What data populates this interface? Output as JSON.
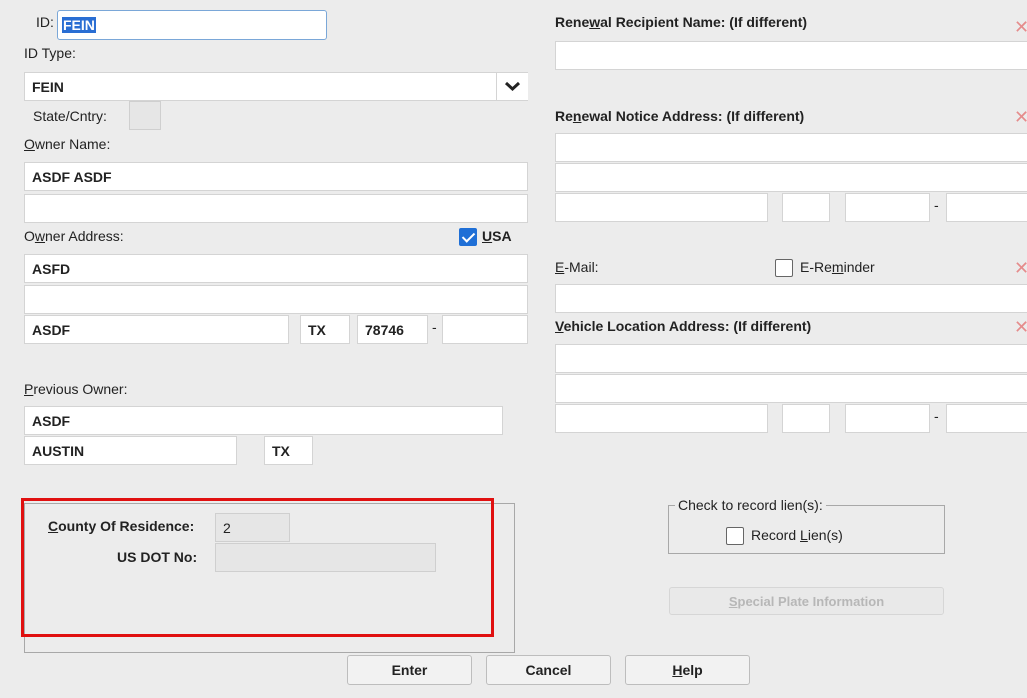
{
  "left": {
    "id_label": "ID:",
    "id_value": "FEIN",
    "id_type_label": "ID Type:",
    "id_type_value": "FEIN",
    "state_label": "State/Cntry:",
    "state_value": "",
    "owner_name_label_u": "O",
    "owner_name_label_rest": "wner Name:",
    "owner_name_1": "ASDF ASDF",
    "owner_name_2": "",
    "owner_address_label_pre": "O",
    "owner_address_label_u": "w",
    "owner_address_label_rest": "ner Address:",
    "usa_u": "U",
    "usa_rest": "SA",
    "address_1": "ASFD",
    "address_2": "",
    "city": "ASDF",
    "state": "TX",
    "zip": "78746",
    "zip_dash": "-",
    "zip_ext": "",
    "previous_owner_label_u": "P",
    "previous_owner_label_rest": "revious Owner:",
    "previous_owner_name": "ASDF",
    "previous_owner_city": "AUSTIN",
    "previous_owner_state": "TX"
  },
  "right": {
    "renewal_recipient_label_pre": "Rene",
    "renewal_recipient_label_u": "w",
    "renewal_recipient_label_rest": "al Recipient Name: (If different)",
    "renewal_recipient_value": "",
    "renewal_address_label_pre": "Re",
    "renewal_address_label_u": "n",
    "renewal_address_label_rest": "ewal Notice Address: (If different)",
    "renewal_dash": "-",
    "email_label_u": "E",
    "email_label_rest": "-Mail:",
    "ereminder_pre": "E-Re",
    "ereminder_u": "m",
    "ereminder_rest": "inder",
    "vehicle_label_u": "V",
    "vehicle_label_rest": "ehicle Location Address: (If different)",
    "vehicle_dash": "-"
  },
  "county": {
    "county_label_u": "C",
    "county_label_rest": "ounty Of Residence:",
    "county_value": "2",
    "dot_label": "US DOT No:",
    "dot_value": ""
  },
  "lien": {
    "group_label": "Check to record lien(s):",
    "record_pre": "Record ",
    "record_u": "L",
    "record_rest": "ien(s)",
    "special_u": "S",
    "special_rest": "pecial Plate Information"
  },
  "buttons": {
    "enter": "Enter",
    "cancel": "Cancel",
    "help_u": "H",
    "help_rest": "elp"
  },
  "colors": {
    "highlight_border": "#e01010",
    "checkbox_checked": "#1f6fd6",
    "clear_icon": "#e58c8c"
  }
}
